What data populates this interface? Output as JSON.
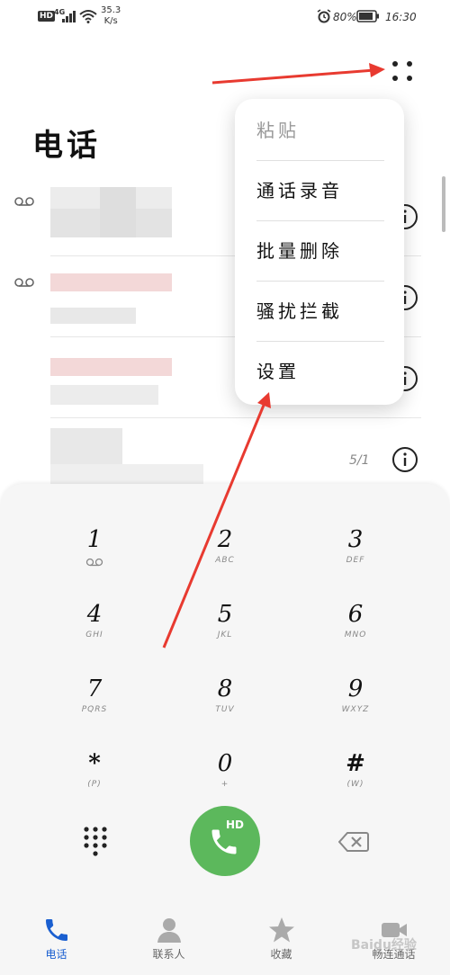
{
  "status_bar": {
    "hd": "HD",
    "network": "4G",
    "speed_value": "35.3",
    "speed_unit": "K/s",
    "battery": "80%",
    "time": "16:30"
  },
  "page": {
    "title": "电话"
  },
  "calls": [
    {
      "voicemail": true,
      "date": ""
    },
    {
      "voicemail": true,
      "date": ""
    },
    {
      "voicemail": false,
      "date": ""
    },
    {
      "voicemail": false,
      "date": "5/1"
    }
  ],
  "menu": {
    "items": [
      {
        "label": "粘贴",
        "disabled": true
      },
      {
        "label": "通话录音",
        "disabled": false
      },
      {
        "label": "批量删除",
        "disabled": false
      },
      {
        "label": "骚扰拦截",
        "disabled": false
      },
      {
        "label": "设置",
        "disabled": false
      }
    ]
  },
  "dialpad": {
    "keys": [
      {
        "digit": "1",
        "letters": ""
      },
      {
        "digit": "2",
        "letters": "ABC"
      },
      {
        "digit": "3",
        "letters": "DEF"
      },
      {
        "digit": "4",
        "letters": "GHI"
      },
      {
        "digit": "5",
        "letters": "JKL"
      },
      {
        "digit": "6",
        "letters": "MNO"
      },
      {
        "digit": "7",
        "letters": "PQRS"
      },
      {
        "digit": "8",
        "letters": "TUV"
      },
      {
        "digit": "9",
        "letters": "WXYZ"
      },
      {
        "digit": "*",
        "letters": "(P)"
      },
      {
        "digit": "0",
        "letters": "+"
      },
      {
        "digit": "#",
        "letters": "(W)"
      }
    ],
    "call_badge": "HD"
  },
  "bottom_nav": [
    {
      "label": "电话",
      "icon": "phone-icon",
      "active": true
    },
    {
      "label": "联系人",
      "icon": "person-icon",
      "active": false
    },
    {
      "label": "收藏",
      "icon": "star-icon",
      "active": false
    },
    {
      "label": "畅连通话",
      "icon": "video-icon",
      "active": false
    }
  ],
  "watermark": "Baidu经验",
  "colors": {
    "call_button": "#5cb85c",
    "active_nav": "#1a5fd0",
    "annotation_arrow": "#e83a30"
  }
}
